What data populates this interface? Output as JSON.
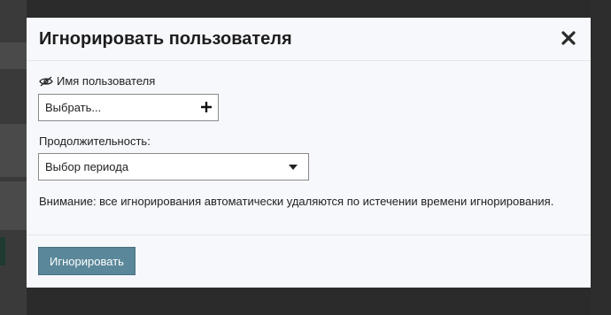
{
  "dialog": {
    "title": "Игнорировать пользователя",
    "user_label": "Имя пользователя",
    "user_placeholder": "Выбрать...",
    "duration_label": "Продолжительность:",
    "duration_value": "Выбор периода",
    "warning": "Внимание: все игнорирования автоматически удаляются по истечении времени игнорирования.",
    "submit_label": "Игнорировать"
  },
  "colors": {
    "modal_bg": "#f7f8fc",
    "button_bg": "#5a8799",
    "overlay": "#2b2b2b"
  },
  "icons": {
    "user_label_icon": "eye-off-icon",
    "user_add_icon": "plus-icon",
    "close_icon": "close-icon",
    "dropdown_icon": "caret-down-icon"
  }
}
